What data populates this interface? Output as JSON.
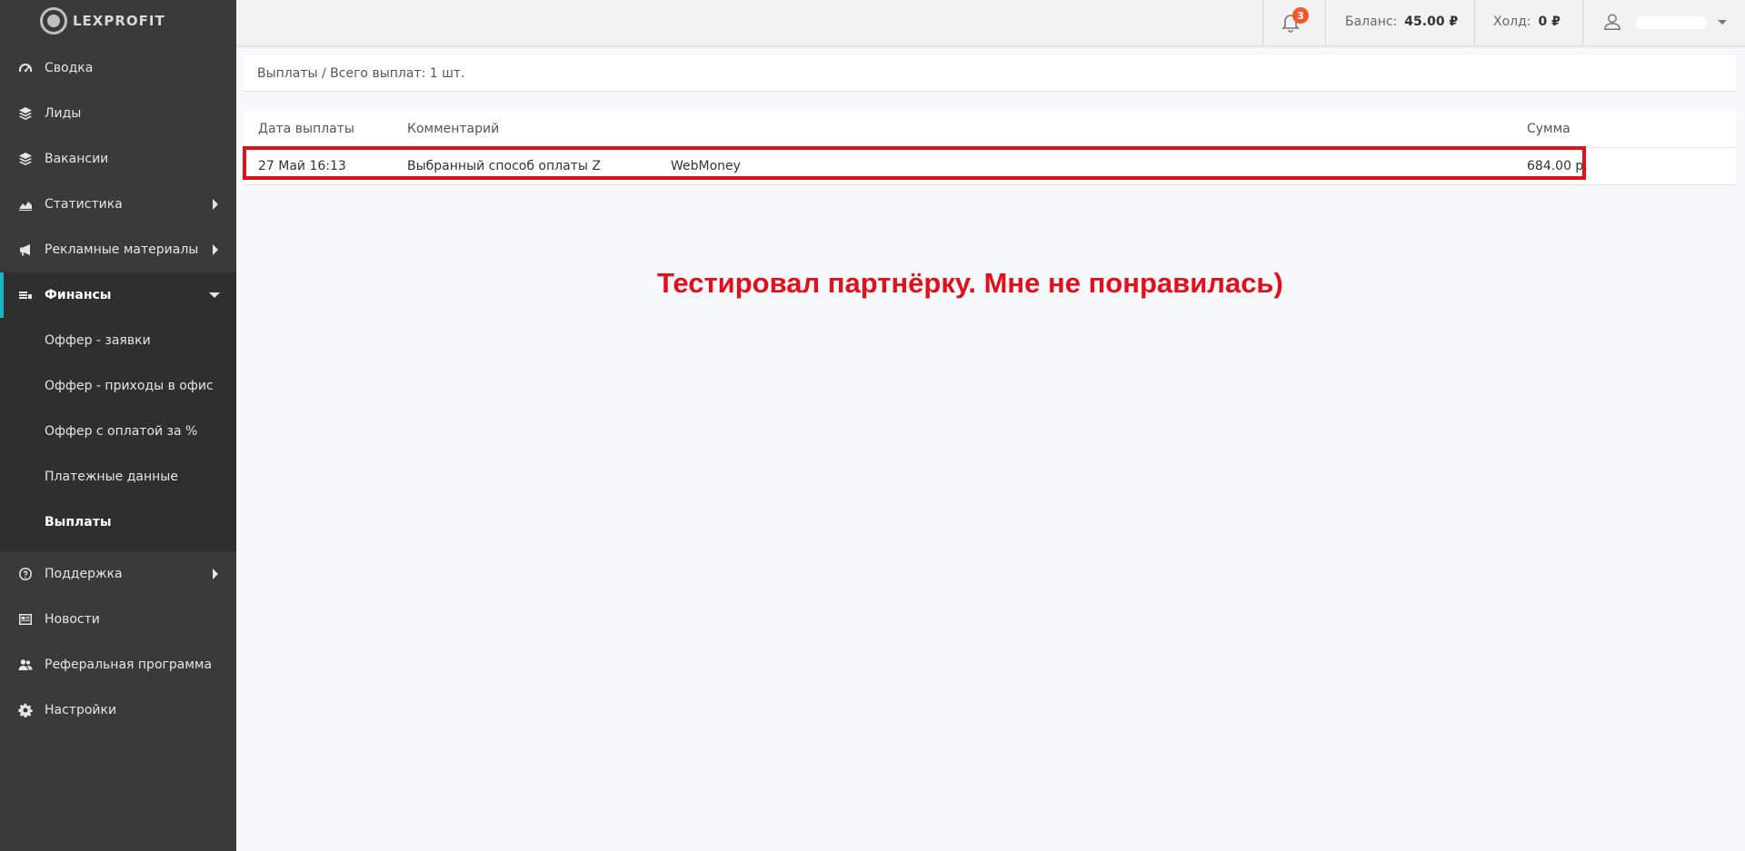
{
  "brand": {
    "name": "LEXPROFIT"
  },
  "sidebar": {
    "items": [
      {
        "label": "Сводка",
        "icon": "speedometer-icon"
      },
      {
        "label": "Лиды",
        "icon": "layers-icon"
      },
      {
        "label": "Вакансии",
        "icon": "layers-icon"
      },
      {
        "label": "Статистика",
        "icon": "area-chart-icon"
      },
      {
        "label": "Рекламные материалы",
        "icon": "megaphone-icon"
      },
      {
        "label": "Финансы",
        "icon": "money-icon"
      },
      {
        "label": "Поддержка",
        "icon": "question-circle-icon"
      },
      {
        "label": "Новости",
        "icon": "newspaper-icon"
      },
      {
        "label": "Реферальная программа",
        "icon": "users-icon"
      },
      {
        "label": "Настройки",
        "icon": "gear-icon"
      }
    ],
    "finance_submenu": [
      {
        "label": "Оффер - заявки"
      },
      {
        "label": "Оффер - приходы в офис"
      },
      {
        "label": "Оффер с оплатой за %"
      },
      {
        "label": "Платежные данные"
      },
      {
        "label": "Выплаты"
      }
    ]
  },
  "topbar": {
    "notifications_count": "3",
    "balance_label": "Баланс:",
    "balance_value": "45.00 ₽",
    "hold_label": "Холд:",
    "hold_value": "0 ₽"
  },
  "breadcrumb": "Выплаты / Всего выплат: 1 шт.",
  "payouts": {
    "columns": {
      "date": "Дата выплаты",
      "comment": "Комментарий",
      "sum": "Сумма"
    },
    "rows": [
      {
        "date": "27 Май 16:13",
        "comment": "Выбранный способ оплаты Z",
        "method": "WebMoney",
        "sum": "684.00 р."
      }
    ]
  },
  "annotation": "Тестировал партнёрку. Мне не понравилась)",
  "colors": {
    "sidebar": "#3a3a3a",
    "active_accent": "#17b7c7",
    "annotation": "#e2101d",
    "badge": "#f05a28"
  }
}
